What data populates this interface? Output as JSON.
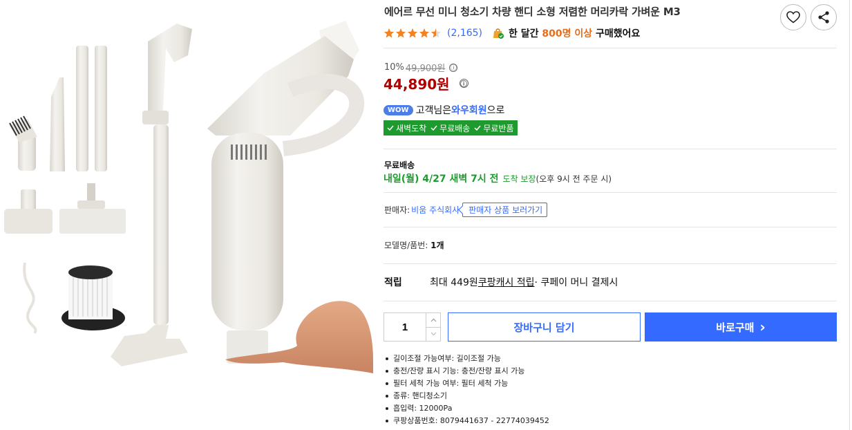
{
  "product": {
    "title": "에어르 무선 미니 청소기 차량 핸디 소형 저렴한 머리카락 가벼운 M3",
    "rating": 4.5,
    "review_count": "(2,165)",
    "buyers_prefix": "한 달간 ",
    "buyers_count": "800명 이상",
    "buyers_suffix": " 구매했어요"
  },
  "price": {
    "discount": "10%",
    "original": "49,900원",
    "final": "44,890원",
    "info_glyph": "ⓘ"
  },
  "wow": {
    "badge": "WOW",
    "prefix": "고객님은 ",
    "member": "와우회원",
    "suffix": "으로",
    "benefits": [
      "새벽도착",
      "무료배송",
      "무료반품"
    ]
  },
  "shipping": {
    "title": "무료배송",
    "date": "내일(월) 4/27 새벽 7시 전",
    "guarantee": "도착 보장",
    "note": "(오후 9시 전 주문 시)"
  },
  "seller": {
    "label": "판매자: ",
    "name": "비움 주식회사",
    "link": "판매자 상품 보러가기"
  },
  "model": {
    "label": "모델명/품번: ",
    "value": "1개"
  },
  "points": {
    "label": "적립",
    "prefix": "최대 449원 ",
    "link": "쿠팡캐시 적립",
    "suffix": " · 쿠페이 머니 결제시"
  },
  "purchase": {
    "quantity": "1",
    "cart_label": "장바구니 담기",
    "buy_label": "바로구매",
    "buy_arrow": "›"
  },
  "specs": [
    "길이조절 가능여부: 길이조절 가능",
    "충전/잔량 표시 기능: 충전/잔량 표시 가능",
    "필터 세척 가능 여부: 필터 세척 가능",
    "종류: 핸디청소기",
    "흡입력: 12000Pa",
    "쿠팡상품번호: 8079441637 - 22774039452"
  ],
  "icons": {
    "wishlist": "heart-icon",
    "share": "share-icon",
    "bag": "shopping-bag-icon",
    "check": "check-icon"
  },
  "colors": {
    "accent": "#346aff",
    "price": "#ae0000",
    "green": "#1e9a2e",
    "star": "#f5821f",
    "buyers_highlight": "#e96c19"
  }
}
